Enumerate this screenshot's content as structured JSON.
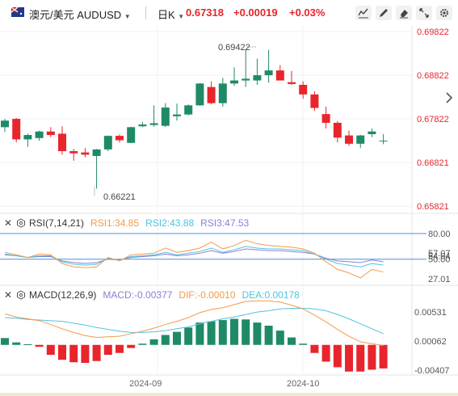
{
  "header": {
    "symbol": "澳元/美元",
    "code": "AUDUSD",
    "timeframe": "日K",
    "last": "0.67318",
    "change": "+0.00019",
    "change_pct": "+0.03%"
  },
  "colors": {
    "up": "#1e8a68",
    "down": "#e8252c",
    "rsi1": "#f29b4a",
    "rsi2": "#4fc3e0",
    "rsi3": "#8a7fd6",
    "dif": "#f29b4a",
    "dea": "#4fc3e0"
  },
  "panels": {
    "rsi_title": "RSI(7,14,21)",
    "rsi1": "RSI1:34.85",
    "rsi2": "RSI2:43.88",
    "rsi3": "RSI3:47.53",
    "macd_title": "MACD(12,26,9)",
    "macd": "MACD:-0.00377",
    "dif": "DIF:-0.00010",
    "dea": "DEA:0.00178"
  },
  "chart_data": {
    "type": "candlestick",
    "price_ticks": [
      "0.69822",
      "0.68822",
      "0.67822",
      "0.66821",
      "0.65821"
    ],
    "rsi_ticks": [
      "80.00",
      "57.07",
      "54.04",
      "50.00",
      "27.01"
    ],
    "macd_ticks": [
      "0.00531",
      "0.00062",
      "-0.00407"
    ],
    "x_ticks": [
      "2024-09",
      "2024-10"
    ],
    "annotations": {
      "high": "0.69422",
      "low": "0.66221"
    },
    "candles": [
      {
        "o": 0.6763,
        "h": 0.6782,
        "l": 0.6752,
        "c": 0.6778
      },
      {
        "o": 0.6782,
        "h": 0.6784,
        "l": 0.6728,
        "c": 0.6735
      },
      {
        "o": 0.6735,
        "h": 0.6748,
        "l": 0.6718,
        "c": 0.6745
      },
      {
        "o": 0.6738,
        "h": 0.6755,
        "l": 0.6732,
        "c": 0.6753
      },
      {
        "o": 0.6753,
        "h": 0.6763,
        "l": 0.674,
        "c": 0.6745
      },
      {
        "o": 0.6748,
        "h": 0.6765,
        "l": 0.67,
        "c": 0.6708
      },
      {
        "o": 0.6708,
        "h": 0.6713,
        "l": 0.6686,
        "c": 0.6703
      },
      {
        "o": 0.6705,
        "h": 0.6715,
        "l": 0.6694,
        "c": 0.67
      },
      {
        "o": 0.6697,
        "h": 0.6713,
        "l": 0.6622,
        "c": 0.6712
      },
      {
        "o": 0.6712,
        "h": 0.6744,
        "l": 0.6708,
        "c": 0.6743
      },
      {
        "o": 0.6743,
        "h": 0.6746,
        "l": 0.6728,
        "c": 0.6733
      },
      {
        "o": 0.6727,
        "h": 0.6764,
        "l": 0.6726,
        "c": 0.6763
      },
      {
        "o": 0.6765,
        "h": 0.6775,
        "l": 0.6763,
        "c": 0.6769
      },
      {
        "o": 0.6768,
        "h": 0.6813,
        "l": 0.6764,
        "c": 0.6772
      },
      {
        "o": 0.6766,
        "h": 0.6818,
        "l": 0.6763,
        "c": 0.6808
      },
      {
        "o": 0.6788,
        "h": 0.6817,
        "l": 0.6778,
        "c": 0.6792
      },
      {
        "o": 0.6792,
        "h": 0.6815,
        "l": 0.679,
        "c": 0.6813
      },
      {
        "o": 0.6813,
        "h": 0.6864,
        "l": 0.6812,
        "c": 0.6863
      },
      {
        "o": 0.6855,
        "h": 0.6868,
        "l": 0.6815,
        "c": 0.6818
      },
      {
        "o": 0.6818,
        "h": 0.6876,
        "l": 0.681,
        "c": 0.6863
      },
      {
        "o": 0.6863,
        "h": 0.69,
        "l": 0.6858,
        "c": 0.687
      },
      {
        "o": 0.687,
        "h": 0.6942,
        "l": 0.6855,
        "c": 0.6874
      },
      {
        "o": 0.687,
        "h": 0.692,
        "l": 0.686,
        "c": 0.6882
      },
      {
        "o": 0.6882,
        "h": 0.694,
        "l": 0.6865,
        "c": 0.6893
      },
      {
        "o": 0.6893,
        "h": 0.6905,
        "l": 0.687,
        "c": 0.687
      },
      {
        "o": 0.6866,
        "h": 0.6892,
        "l": 0.686,
        "c": 0.6862
      },
      {
        "o": 0.686,
        "h": 0.6868,
        "l": 0.6828,
        "c": 0.6838
      },
      {
        "o": 0.6838,
        "h": 0.6845,
        "l": 0.68,
        "c": 0.6807
      },
      {
        "o": 0.6793,
        "h": 0.681,
        "l": 0.676,
        "c": 0.6773
      },
      {
        "o": 0.6773,
        "h": 0.6777,
        "l": 0.6728,
        "c": 0.6739
      },
      {
        "o": 0.6744,
        "h": 0.6755,
        "l": 0.672,
        "c": 0.6725
      },
      {
        "o": 0.6725,
        "h": 0.6745,
        "l": 0.6715,
        "c": 0.6744
      },
      {
        "o": 0.6747,
        "h": 0.676,
        "l": 0.674,
        "c": 0.6753
      },
      {
        "o": 0.6732,
        "h": 0.6747,
        "l": 0.6724,
        "c": 0.6732
      }
    ],
    "rsi1": [
      58,
      55,
      52,
      56,
      55,
      45,
      41,
      40,
      41,
      52,
      48,
      55,
      56,
      57,
      63,
      58,
      60,
      63,
      70,
      62,
      66,
      72,
      68,
      66,
      65,
      64,
      62,
      57,
      47,
      38,
      34,
      28,
      38,
      35
    ],
    "rsi2": [
      56,
      54,
      52,
      54,
      54,
      47,
      44,
      43,
      44,
      51,
      49,
      53,
      54,
      55,
      58,
      55,
      57,
      59,
      63,
      58,
      61,
      65,
      63,
      62,
      62,
      61,
      60,
      56,
      50,
      45,
      43,
      41,
      45,
      43
    ],
    "rsi3": [
      55,
      54,
      52,
      53,
      53,
      48,
      46,
      45,
      46,
      50,
      49,
      52,
      53,
      54,
      56,
      54,
      55,
      57,
      60,
      57,
      59,
      62,
      61,
      60,
      60,
      59,
      58,
      56,
      51,
      48,
      47,
      46,
      49,
      47
    ],
    "macd_hist": [
      0.0011,
      0.0004,
      0.0001,
      -0.0003,
      -0.0016,
      -0.0024,
      -0.0028,
      -0.0029,
      -0.0026,
      -0.0016,
      -0.0013,
      -0.0005,
      0.0002,
      0.0009,
      0.0016,
      0.0021,
      0.0028,
      0.0036,
      0.0038,
      0.004,
      0.0042,
      0.0041,
      0.0036,
      0.0031,
      0.0023,
      0.0012,
      0.0002,
      -0.0013,
      -0.0027,
      -0.0036,
      -0.0043,
      -0.0043,
      -0.004,
      -0.0038
    ],
    "dif": [
      0.005,
      0.0045,
      0.0042,
      0.0039,
      0.0033,
      0.0026,
      0.002,
      0.0015,
      0.0012,
      0.0013,
      0.0014,
      0.0018,
      0.0022,
      0.0027,
      0.0033,
      0.0038,
      0.0044,
      0.0052,
      0.0057,
      0.006,
      0.0065,
      0.007,
      0.0071,
      0.0071,
      0.0069,
      0.0064,
      0.0058,
      0.0048,
      0.0037,
      0.0025,
      0.0014,
      0.0005,
      0.0002,
      -0.0001
    ],
    "dea": [
      0.0044,
      0.0043,
      0.0041,
      0.004,
      0.0039,
      0.0038,
      0.0035,
      0.0032,
      0.0028,
      0.0025,
      0.0022,
      0.002,
      0.002,
      0.0021,
      0.0023,
      0.0026,
      0.0029,
      0.0034,
      0.0038,
      0.0042,
      0.0045,
      0.0049,
      0.0053,
      0.0055,
      0.0058,
      0.0059,
      0.0059,
      0.0058,
      0.0055,
      0.0049,
      0.0042,
      0.0034,
      0.0026,
      0.0018
    ]
  }
}
